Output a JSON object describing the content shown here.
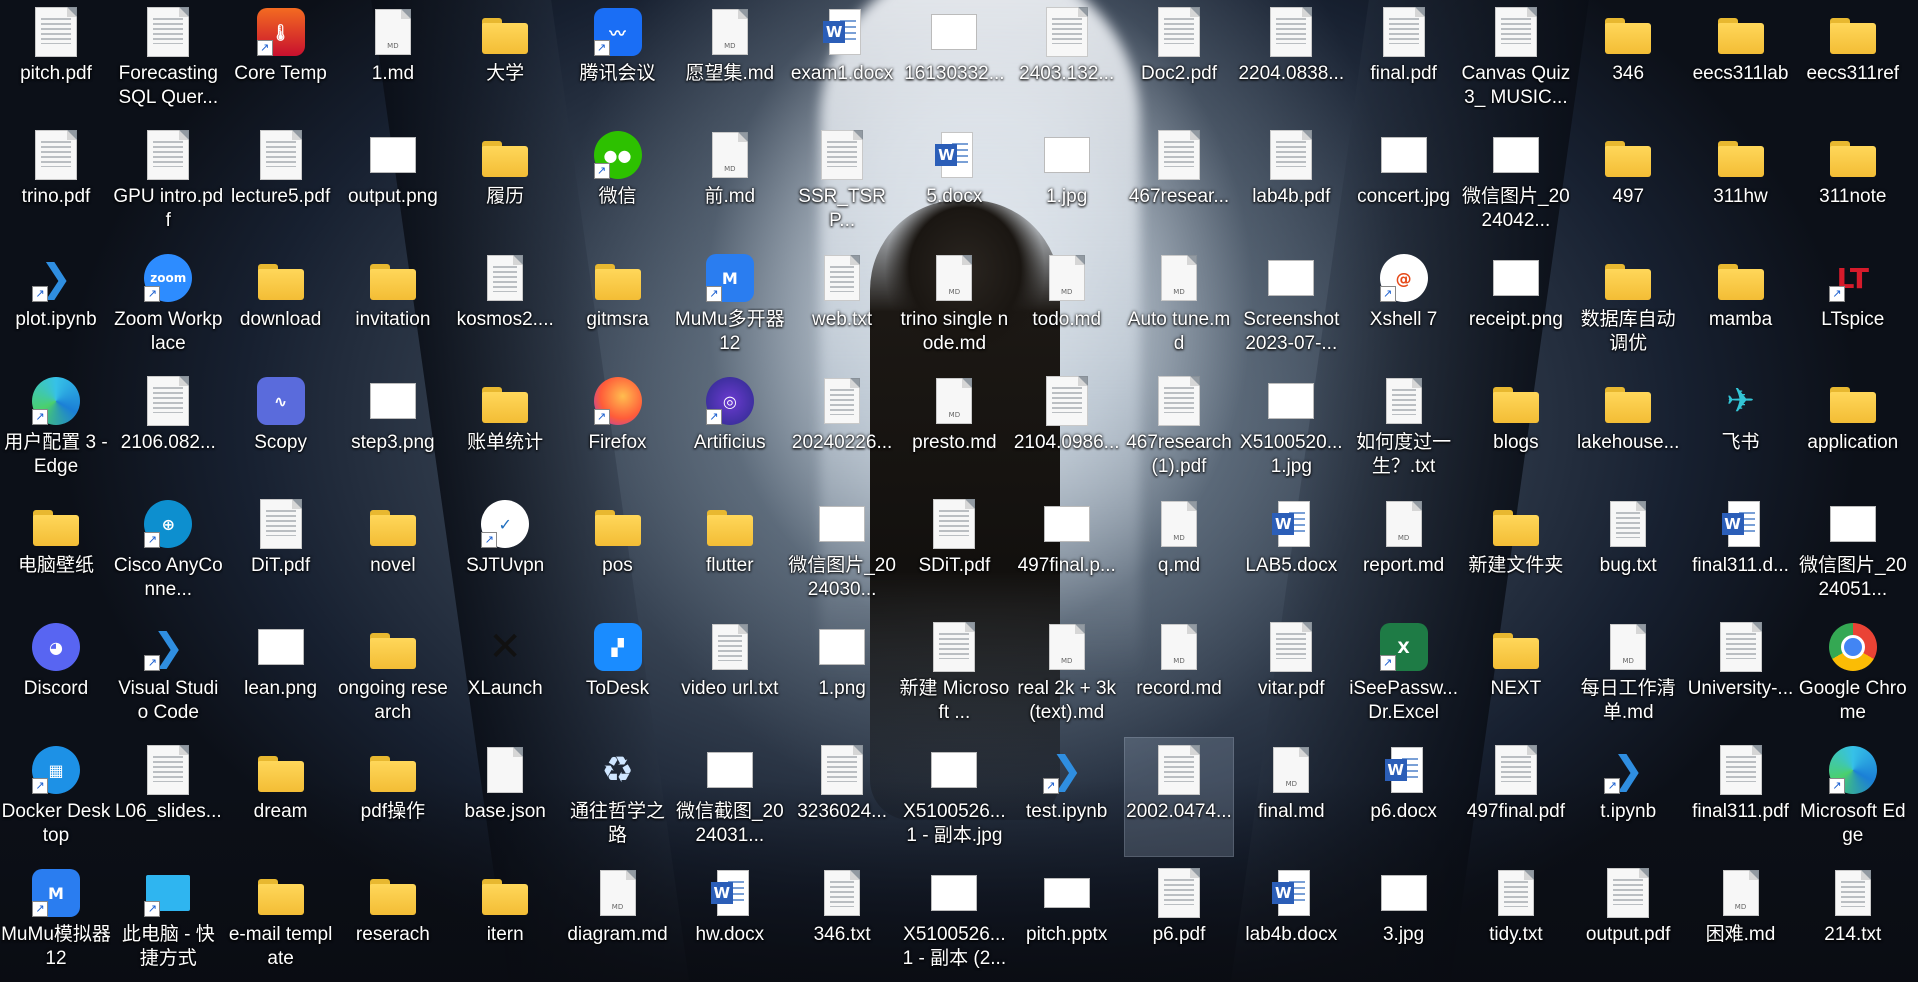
{
  "desktop": {
    "items": [
      {
        "label": "pitch.pdf",
        "icon": "pdf-icon",
        "col": 0,
        "row": 0
      },
      {
        "label": "Forecasting SQL Quer...",
        "icon": "pdf-icon",
        "col": 1,
        "row": 0
      },
      {
        "label": "Core Temp",
        "icon": "core-temp-icon",
        "col": 2,
        "row": 0
      },
      {
        "label": "1.md",
        "icon": "markdown-file-icon",
        "col": 3,
        "row": 0
      },
      {
        "label": "大学",
        "icon": "folder-icon",
        "col": 4,
        "row": 0
      },
      {
        "label": "腾讯会议",
        "icon": "tencent-meeting-icon",
        "col": 5,
        "row": 0
      },
      {
        "label": "愿望集.md",
        "icon": "markdown-file-icon",
        "col": 6,
        "row": 0
      },
      {
        "label": "exam1.docx",
        "icon": "word-icon",
        "col": 7,
        "row": 0
      },
      {
        "label": "16130332...",
        "icon": "image-icon",
        "col": 8,
        "row": 0
      },
      {
        "label": "2403.132...",
        "icon": "pdf-icon",
        "col": 9,
        "row": 0
      },
      {
        "label": "Doc2.pdf",
        "icon": "pdf-icon",
        "col": 10,
        "row": 0
      },
      {
        "label": "2204.0838...",
        "icon": "pdf-icon",
        "col": 11,
        "row": 0
      },
      {
        "label": "final.pdf",
        "icon": "pdf-icon",
        "col": 12,
        "row": 0
      },
      {
        "label": "Canvas Quiz 3_ MUSIC...",
        "icon": "pdf-icon",
        "col": 13,
        "row": 0
      },
      {
        "label": "346",
        "icon": "folder-icon",
        "col": 14,
        "row": 0
      },
      {
        "label": "eecs311lab",
        "icon": "folder-icon",
        "col": 15,
        "row": 0
      },
      {
        "label": "eecs311ref",
        "icon": "folder-icon",
        "col": 16,
        "row": 0
      },
      {
        "label": "trino.pdf",
        "icon": "pdf-icon",
        "col": 0,
        "row": 1
      },
      {
        "label": "GPU intro.pdf",
        "icon": "pdf-icon",
        "col": 1,
        "row": 1
      },
      {
        "label": "lecture5.pdf",
        "icon": "pdf-icon",
        "col": 2,
        "row": 1
      },
      {
        "label": "output.png",
        "icon": "image-icon",
        "col": 3,
        "row": 1
      },
      {
        "label": "履历",
        "icon": "folder-icon",
        "col": 4,
        "row": 1
      },
      {
        "label": "微信",
        "icon": "wechat-icon",
        "col": 5,
        "row": 1
      },
      {
        "label": "前.md",
        "icon": "markdown-file-icon",
        "col": 6,
        "row": 1
      },
      {
        "label": "SSR_TSRP...",
        "icon": "pdf-icon",
        "col": 7,
        "row": 1
      },
      {
        "label": "5.docx",
        "icon": "word-icon",
        "col": 8,
        "row": 1
      },
      {
        "label": "1.jpg",
        "icon": "image-icon",
        "col": 9,
        "row": 1
      },
      {
        "label": "467resear...",
        "icon": "pdf-icon",
        "col": 10,
        "row": 1
      },
      {
        "label": "lab4b.pdf",
        "icon": "pdf-icon",
        "col": 11,
        "row": 1
      },
      {
        "label": "concert.jpg",
        "icon": "image-icon",
        "col": 12,
        "row": 1
      },
      {
        "label": "微信图片_2024042...",
        "icon": "image-icon",
        "col": 13,
        "row": 1
      },
      {
        "label": "497",
        "icon": "folder-icon",
        "col": 14,
        "row": 1
      },
      {
        "label": "311hw",
        "icon": "folder-icon",
        "col": 15,
        "row": 1
      },
      {
        "label": "311note",
        "icon": "folder-icon",
        "col": 16,
        "row": 1
      },
      {
        "label": "plot.ipynb",
        "icon": "vscode-icon",
        "col": 0,
        "row": 2
      },
      {
        "label": "Zoom Workplace",
        "icon": "zoom-icon",
        "col": 1,
        "row": 2
      },
      {
        "label": "download",
        "icon": "download-folder-icon",
        "col": 2,
        "row": 2
      },
      {
        "label": "invitation",
        "icon": "folder-icon",
        "col": 3,
        "row": 2
      },
      {
        "label": "kosmos2....",
        "icon": "text-file-icon",
        "col": 4,
        "row": 2
      },
      {
        "label": "gitmsra",
        "icon": "folder-icon",
        "col": 5,
        "row": 2
      },
      {
        "label": "MuMu多开器12",
        "icon": "mumu-icon",
        "col": 6,
        "row": 2
      },
      {
        "label": "web.txt",
        "icon": "text-file-icon",
        "col": 7,
        "row": 2
      },
      {
        "label": "trino single node.md",
        "icon": "markdown-file-icon",
        "col": 8,
        "row": 2
      },
      {
        "label": "todo.md",
        "icon": "markdown-file-icon",
        "col": 9,
        "row": 2
      },
      {
        "label": "Auto tune.md",
        "icon": "markdown-file-icon",
        "col": 10,
        "row": 2
      },
      {
        "label": "Screenshot 2023-07-...",
        "icon": "image-icon",
        "col": 11,
        "row": 2
      },
      {
        "label": "Xshell 7",
        "icon": "xshell-icon",
        "col": 12,
        "row": 2
      },
      {
        "label": "receipt.png",
        "icon": "image-icon",
        "col": 13,
        "row": 2
      },
      {
        "label": "数据库自动调优",
        "icon": "folder-icon",
        "col": 14,
        "row": 2
      },
      {
        "label": "mamba",
        "icon": "folder-icon",
        "col": 15,
        "row": 2
      },
      {
        "label": "LTspice",
        "icon": "ltspice-icon",
        "col": 16,
        "row": 2
      },
      {
        "label": "用户配置 3 - Edge",
        "icon": "edge-icon",
        "col": 0,
        "row": 3
      },
      {
        "label": "2106.082...",
        "icon": "pdf-icon",
        "col": 1,
        "row": 3
      },
      {
        "label": "Scopy",
        "icon": "scopy-icon",
        "col": 2,
        "row": 3
      },
      {
        "label": "step3.png",
        "icon": "image-icon",
        "col": 3,
        "row": 3
      },
      {
        "label": "账单统计",
        "icon": "folder-icon",
        "col": 4,
        "row": 3
      },
      {
        "label": "Firefox",
        "icon": "firefox-icon",
        "col": 5,
        "row": 3
      },
      {
        "label": "Artificius",
        "icon": "artificius-icon",
        "col": 6,
        "row": 3
      },
      {
        "label": "20240226...",
        "icon": "text-file-icon",
        "col": 7,
        "row": 3
      },
      {
        "label": "presto.md",
        "icon": "markdown-file-icon",
        "col": 8,
        "row": 3
      },
      {
        "label": "2104.0986...",
        "icon": "pdf-icon",
        "col": 9,
        "row": 3
      },
      {
        "label": "467research (1).pdf",
        "icon": "pdf-icon",
        "col": 10,
        "row": 3
      },
      {
        "label": "X5100520... 1.jpg",
        "icon": "image-icon",
        "col": 11,
        "row": 3
      },
      {
        "label": "如何度过一生？.txt",
        "icon": "text-file-icon",
        "col": 12,
        "row": 3
      },
      {
        "label": "blogs",
        "icon": "folder-icon",
        "col": 13,
        "row": 3
      },
      {
        "label": "lakehouse...",
        "icon": "folder-icon",
        "col": 14,
        "row": 3
      },
      {
        "label": "飞书",
        "icon": "feishu-icon",
        "col": 15,
        "row": 3
      },
      {
        "label": "application",
        "icon": "folder-icon",
        "col": 16,
        "row": 3
      },
      {
        "label": "电脑壁纸",
        "icon": "folder-icon",
        "col": 0,
        "row": 4
      },
      {
        "label": "Cisco AnyConne...",
        "icon": "cisco-icon",
        "col": 1,
        "row": 4
      },
      {
        "label": "DiT.pdf",
        "icon": "pdf-icon",
        "col": 2,
        "row": 4
      },
      {
        "label": "novel",
        "icon": "folder-icon",
        "col": 3,
        "row": 4
      },
      {
        "label": "SJTUvpn",
        "icon": "sjtu-vpn-icon",
        "col": 4,
        "row": 4
      },
      {
        "label": "pos",
        "icon": "folder-icon",
        "col": 5,
        "row": 4
      },
      {
        "label": "flutter",
        "icon": "folder-icon",
        "col": 6,
        "row": 4
      },
      {
        "label": "微信图片_2024030...",
        "icon": "image-icon",
        "col": 7,
        "row": 4
      },
      {
        "label": "SDiT.pdf",
        "icon": "pdf-icon",
        "col": 8,
        "row": 4
      },
      {
        "label": "497final.p...",
        "icon": "image-icon",
        "col": 9,
        "row": 4
      },
      {
        "label": "q.md",
        "icon": "markdown-file-icon",
        "col": 10,
        "row": 4
      },
      {
        "label": "LAB5.docx",
        "icon": "word-icon",
        "col": 11,
        "row": 4
      },
      {
        "label": "report.md",
        "icon": "markdown-file-icon",
        "col": 12,
        "row": 4
      },
      {
        "label": "新建文件夹",
        "icon": "folder-icon",
        "col": 13,
        "row": 4
      },
      {
        "label": "bug.txt",
        "icon": "text-file-icon",
        "col": 14,
        "row": 4
      },
      {
        "label": "final311.d...",
        "icon": "word-icon",
        "col": 15,
        "row": 4
      },
      {
        "label": "微信图片_2024051...",
        "icon": "image-icon",
        "col": 16,
        "row": 4
      },
      {
        "label": "Discord",
        "icon": "discord-icon",
        "col": 0,
        "row": 5
      },
      {
        "label": "Visual Studio Code",
        "icon": "vscode-icon",
        "col": 1,
        "row": 5
      },
      {
        "label": "lean.png",
        "icon": "image-icon",
        "col": 2,
        "row": 5
      },
      {
        "label": "ongoing research",
        "icon": "folder-icon",
        "col": 3,
        "row": 5
      },
      {
        "label": "XLaunch",
        "icon": "xlaunch-icon",
        "col": 4,
        "row": 5
      },
      {
        "label": "ToDesk",
        "icon": "todesk-icon",
        "col": 5,
        "row": 5
      },
      {
        "label": "video url.txt",
        "icon": "text-file-icon",
        "col": 6,
        "row": 5
      },
      {
        "label": "1.png",
        "icon": "image-icon",
        "col": 7,
        "row": 5
      },
      {
        "label": "新建 Microsoft ...",
        "icon": "pdf-icon",
        "col": 8,
        "row": 5
      },
      {
        "label": "real 2k + 3k(text).md",
        "icon": "markdown-file-icon",
        "col": 9,
        "row": 5
      },
      {
        "label": "record.md",
        "icon": "markdown-file-icon",
        "col": 10,
        "row": 5
      },
      {
        "label": "vitar.pdf",
        "icon": "pdf-icon",
        "col": 11,
        "row": 5
      },
      {
        "label": "iSeePassw... Dr.Excel",
        "icon": "excel-icon",
        "col": 12,
        "row": 5
      },
      {
        "label": "NEXT",
        "icon": "folder-icon",
        "col": 13,
        "row": 5
      },
      {
        "label": "每日工作清单.md",
        "icon": "markdown-file-icon",
        "col": 14,
        "row": 5
      },
      {
        "label": "University-...",
        "icon": "pdf-icon",
        "col": 15,
        "row": 5
      },
      {
        "label": "Google Chrome",
        "icon": "chrome-icon",
        "col": 16,
        "row": 5
      },
      {
        "label": "Docker Desktop",
        "icon": "docker-icon",
        "col": 0,
        "row": 6
      },
      {
        "label": "L06_slides...",
        "icon": "pdf-icon",
        "col": 1,
        "row": 6
      },
      {
        "label": "dream",
        "icon": "folder-icon",
        "col": 2,
        "row": 6
      },
      {
        "label": "pdf操作",
        "icon": "folder-icon",
        "col": 3,
        "row": 6
      },
      {
        "label": "base.json",
        "icon": "json-file-icon",
        "col": 4,
        "row": 6
      },
      {
        "label": "通往哲学之路",
        "icon": "recycle-bin-icon",
        "col": 5,
        "row": 6
      },
      {
        "label": "微信截图_2024031...",
        "icon": "image-icon",
        "col": 6,
        "row": 6
      },
      {
        "label": "3236024...",
        "icon": "pdf-icon",
        "col": 7,
        "row": 6
      },
      {
        "label": "X5100526... 1 - 副本.jpg",
        "icon": "image-icon",
        "col": 8,
        "row": 6
      },
      {
        "label": "test.ipynb",
        "icon": "vscode-icon",
        "col": 9,
        "row": 6
      },
      {
        "label": "2002.0474...",
        "icon": "pdf-icon",
        "col": 10,
        "row": 6,
        "selected": true
      },
      {
        "label": "final.md",
        "icon": "markdown-file-icon",
        "col": 11,
        "row": 6
      },
      {
        "label": "p6.docx",
        "icon": "word-icon",
        "col": 12,
        "row": 6
      },
      {
        "label": "497final.pdf",
        "icon": "pdf-icon",
        "col": 13,
        "row": 6
      },
      {
        "label": "t.ipynb",
        "icon": "vscode-icon",
        "col": 14,
        "row": 6
      },
      {
        "label": "final311.pdf",
        "icon": "pdf-icon",
        "col": 15,
        "row": 6
      },
      {
        "label": "Microsoft Edge",
        "icon": "edge-icon",
        "col": 16,
        "row": 6
      },
      {
        "label": "MuMu模拟器12",
        "icon": "mumu-icon",
        "col": 0,
        "row": 7
      },
      {
        "label": "此电脑 - 快捷方式",
        "icon": "this-pc-icon",
        "col": 1,
        "row": 7
      },
      {
        "label": "e-mail template",
        "icon": "folder-icon",
        "col": 2,
        "row": 7
      },
      {
        "label": "reserach",
        "icon": "folder-icon",
        "col": 3,
        "row": 7
      },
      {
        "label": "itern",
        "icon": "folder-icon",
        "col": 4,
        "row": 7
      },
      {
        "label": "diagram.md",
        "icon": "markdown-file-icon",
        "col": 5,
        "row": 7
      },
      {
        "label": "hw.docx",
        "icon": "word-icon",
        "col": 6,
        "row": 7
      },
      {
        "label": "346.txt",
        "icon": "text-file-icon",
        "col": 7,
        "row": 7
      },
      {
        "label": "X5100526... 1 - 副本 (2...",
        "icon": "image-icon",
        "col": 8,
        "row": 7
      },
      {
        "label": "pitch.pptx",
        "icon": "powerpoint-icon",
        "col": 9,
        "row": 7
      },
      {
        "label": "p6.pdf",
        "icon": "pdf-icon",
        "col": 10,
        "row": 7
      },
      {
        "label": "lab4b.docx",
        "icon": "word-icon",
        "col": 11,
        "row": 7
      },
      {
        "label": "3.jpg",
        "icon": "image-icon",
        "col": 12,
        "row": 7
      },
      {
        "label": "tidy.txt",
        "icon": "text-file-icon",
        "col": 13,
        "row": 7
      },
      {
        "label": "output.pdf",
        "icon": "pdf-icon",
        "col": 14,
        "row": 7
      },
      {
        "label": "困难.md",
        "icon": "markdown-file-icon",
        "col": 15,
        "row": 7
      },
      {
        "label": "214.txt",
        "icon": "text-file-icon",
        "col": 16,
        "row": 7
      }
    ]
  },
  "colors": {
    "folder": "#f5c542",
    "word": "#2b5eb8",
    "vscode": "#2f8ee0",
    "selection": "#b4c8e1"
  }
}
